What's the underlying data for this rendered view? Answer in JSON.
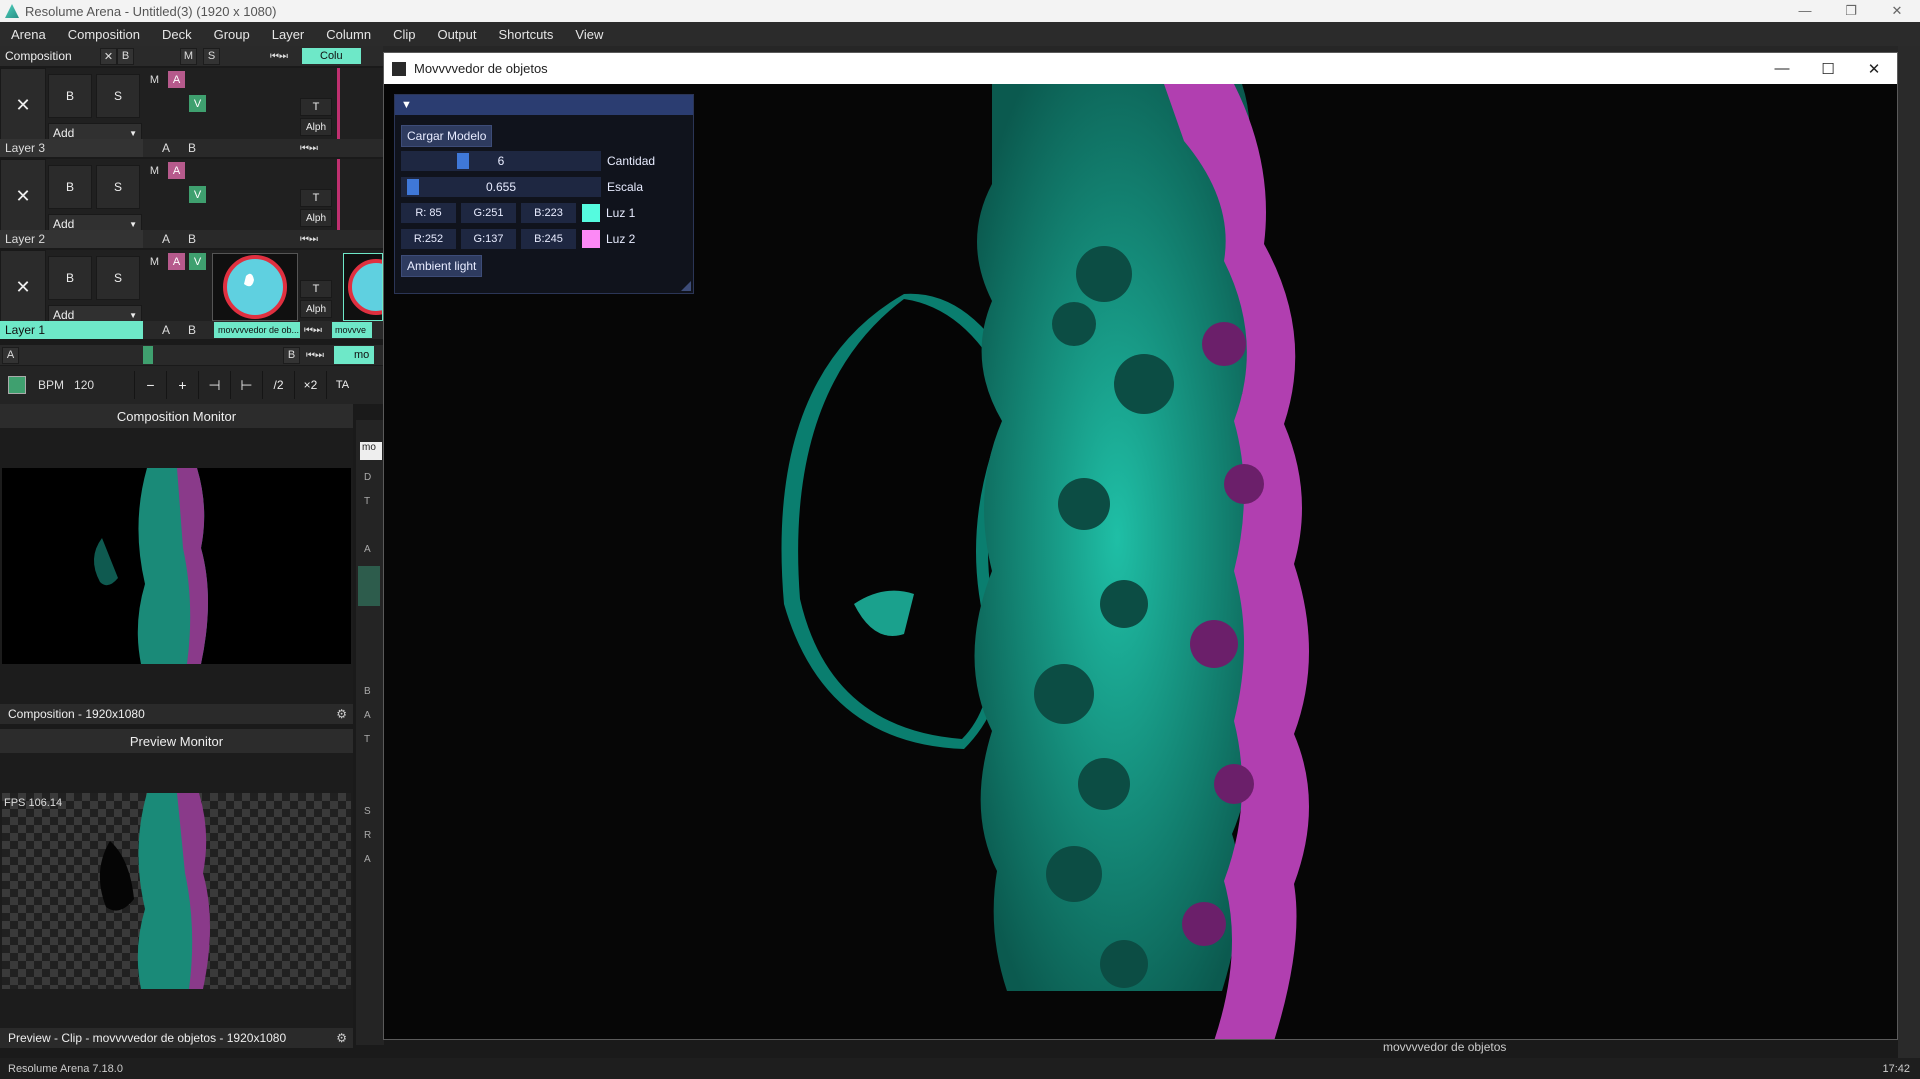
{
  "app": {
    "title": "Resolume Arena - Untitled(3) (1920 x 1080)",
    "version": "Resolume Arena 7.18.0",
    "clock": "17:42"
  },
  "menu": [
    "Arena",
    "Composition",
    "Deck",
    "Group",
    "Layer",
    "Column",
    "Clip",
    "Output",
    "Shortcuts",
    "View"
  ],
  "composition": {
    "label": "Composition",
    "x": "✕",
    "b": "B",
    "m": "M",
    "s": "S",
    "col_tab": "Colu"
  },
  "layers": [
    {
      "name": "Layer 3",
      "add": "Add",
      "b": "B",
      "s": "S",
      "m": "M",
      "a": "A",
      "v": "V",
      "t": "T",
      "alph": "Alph",
      "ab_a": "A",
      "ab_b": "B"
    },
    {
      "name": "Layer 2",
      "add": "Add",
      "b": "B",
      "s": "S",
      "m": "M",
      "a": "A",
      "v": "V",
      "t": "T",
      "alph": "Alph",
      "ab_a": "A",
      "ab_b": "B"
    },
    {
      "name": "Layer 1",
      "add": "Add",
      "b": "B",
      "s": "S",
      "m": "M",
      "a": "A",
      "v": "V",
      "t": "T",
      "alph": "Alph",
      "ab_a": "A",
      "ab_b": "B",
      "clip": "movvvvedor de ob...",
      "clip2": "movvve"
    }
  ],
  "crossfader": {
    "a": "A",
    "b": "B",
    "col": "mo"
  },
  "bpm": {
    "label": "BPM",
    "value": "120",
    "minus": "−",
    "plus": "+",
    "half": "/2",
    "double": "×2",
    "tap": "TA"
  },
  "composition_monitor": {
    "title": "Composition Monitor",
    "footer": "Composition - 1920x1080"
  },
  "preview_monitor": {
    "title": "Preview Monitor",
    "fps": "FPS 106.14",
    "footer": "Preview - Clip - movvvvedor de objetos - 1920x1080"
  },
  "side_letters": [
    "D",
    "T",
    "A",
    "B",
    "A",
    "T",
    "S",
    "R",
    "A"
  ],
  "search_stub": "mo",
  "bottom_clip_name": "movvvvedor de objetos",
  "window": {
    "title": "Movvvvedor de objetos",
    "min": "—",
    "max": "☐",
    "close": "✕"
  },
  "gui": {
    "load_button": "Cargar Modelo",
    "cantidad": {
      "value": "6",
      "label": "Cantidad",
      "fraction": 0.3
    },
    "escala": {
      "value": "0.655",
      "label": "Escala",
      "fraction": 0.03
    },
    "luz1": {
      "r": "R: 85",
      "g": "G:251",
      "b": "B:223",
      "label": "Luz 1",
      "color": "#55fbdf"
    },
    "luz2": {
      "r": "R:252",
      "g": "G:137",
      "b": "B:245",
      "label": "Luz 2",
      "color": "#fc89f5"
    },
    "ambient_button": "Ambient light"
  },
  "colors": {
    "teal": "#1fbfa6",
    "magenta": "#b13fb0",
    "accent_mint": "#6ee8c8"
  }
}
